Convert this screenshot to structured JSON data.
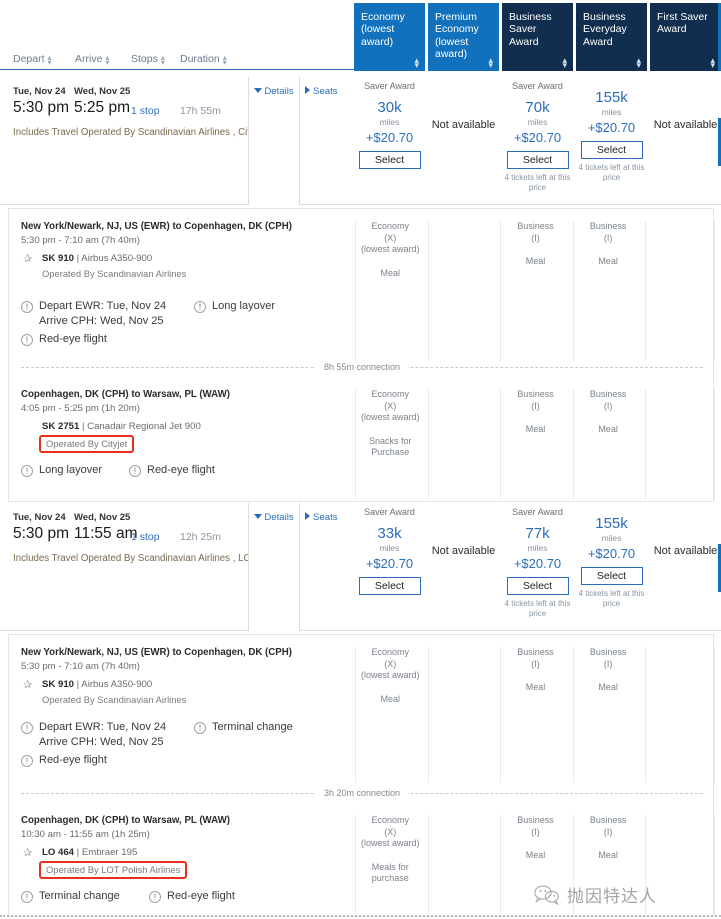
{
  "sort_bar": {
    "items": [
      {
        "label": "Depart",
        "name": "depart"
      },
      {
        "label": "Arrive",
        "name": "arrive"
      },
      {
        "label": "Stops",
        "name": "stops"
      },
      {
        "label": "Duration",
        "name": "duration"
      }
    ]
  },
  "fare_columns": [
    {
      "label": "Economy\n(lowest award)",
      "l1": "Economy",
      "l2": "(lowest",
      "l3": "award)",
      "shade": "light"
    },
    {
      "label": "Premium Economy (lowest award)",
      "l1": "Premium",
      "l2": "Economy",
      "l3": "(lowest",
      "l4": "award)",
      "shade": "light"
    },
    {
      "label": "Business Saver Award",
      "l1": "Business",
      "l2": "Saver Award",
      "shade": "dark"
    },
    {
      "label": "Business Everyday Award",
      "l1": "Business",
      "l2": "Everyday",
      "l3": "Award",
      "shade": "dark"
    },
    {
      "label": "First Saver Award",
      "l1": "First Saver",
      "l2": "Award",
      "shade": "dark"
    }
  ],
  "colors": {
    "header_light_blue": "#1271bc",
    "header_dark_navy": "#122e4f",
    "link_blue": "#2a6ebb",
    "highlight_red": "#e8301e"
  },
  "results": [
    {
      "depart_date": "Tue, Nov 24",
      "depart_time": "5:30 pm",
      "arrive_date": "Wed, Nov 25",
      "arrive_time": "5:25 pm",
      "stops": "1 stop",
      "duration": "17h 55m",
      "includes": "Includes Travel Operated By Scandinavian Airlines , Cityjet",
      "details_label": "Details",
      "seats_label": "Seats",
      "fares": [
        {
          "saver": "Saver Award",
          "miles": "30k",
          "miles_word": "miles",
          "price": "+$20.70",
          "select": "Select",
          "tickets_left": "",
          "not_available": ""
        },
        {
          "saver": "",
          "miles": "",
          "miles_word": "",
          "price": "",
          "select": "",
          "tickets_left": "",
          "not_available": "Not available"
        },
        {
          "saver": "Saver Award",
          "miles": "70k",
          "miles_word": "miles",
          "price": "+$20.70",
          "select": "Select",
          "tickets_left": "4 tickets left at this price",
          "not_available": ""
        },
        {
          "saver": "",
          "miles": "155k",
          "miles_word": "miles",
          "price": "+$20.70",
          "select": "Select",
          "tickets_left": "4 tickets left at this price",
          "not_available": ""
        },
        {
          "saver": "",
          "miles": "",
          "miles_word": "",
          "price": "",
          "select": "",
          "tickets_left": "",
          "not_available": "Not available"
        }
      ],
      "segments": [
        {
          "route": "New York/Newark, NJ, US (EWR) to Copenhagen, DK (CPH)",
          "times": "5:30 pm - 7:10 am (7h 40m)",
          "flight_no": "SK 910",
          "equipment": "Airbus A350-900",
          "operated_by": "Operated By Scandinavian Airlines",
          "operated_highlight": false,
          "notes_left": [
            "Depart EWR: Tue, Nov 24",
            "Arrive CPH: Wed, Nov 25"
          ],
          "note_right": "Long layover",
          "note_bottom": "Red-eye flight",
          "cabins": [
            {
              "l1": "Economy",
              "l2": "(X)",
              "l3": "(lowest award)",
              "meal": "Meal"
            },
            {
              "l1": "",
              "l2": "",
              "l3": "",
              "meal": ""
            },
            {
              "l1": "Business",
              "l2": "(I)",
              "l3": "",
              "meal": "Meal"
            },
            {
              "l1": "Business",
              "l2": "(I)",
              "l3": "",
              "meal": "Meal"
            },
            {
              "l1": "",
              "l2": "",
              "l3": "",
              "meal": ""
            }
          ]
        },
        {
          "connection": "8h 55m connection",
          "route": "Copenhagen, DK (CPH) to Warsaw, PL (WAW)",
          "times": "4:05 pm - 5:25 pm (1h 20m)",
          "flight_no": "SK 2751",
          "equipment": "Canadair Regional Jet 900",
          "operated_by": "Operated By Cityjet",
          "operated_highlight": true,
          "notes_left": [],
          "note_right": "Red-eye flight",
          "note_bottom": "Long layover",
          "cabins": [
            {
              "l1": "Economy",
              "l2": "(X)",
              "l3": "(lowest award)",
              "meal": "Snacks for Purchase"
            },
            {
              "l1": "",
              "l2": "",
              "l3": "",
              "meal": ""
            },
            {
              "l1": "Business",
              "l2": "(I)",
              "l3": "",
              "meal": "Meal"
            },
            {
              "l1": "Business",
              "l2": "(I)",
              "l3": "",
              "meal": "Meal"
            },
            {
              "l1": "",
              "l2": "",
              "l3": "",
              "meal": ""
            }
          ]
        }
      ]
    },
    {
      "depart_date": "Tue, Nov 24",
      "depart_time": "5:30 pm",
      "arrive_date": "Wed, Nov 25",
      "arrive_time": "11:55 am",
      "stops": "1 stop",
      "duration": "12h 25m",
      "includes": "Includes Travel Operated By Scandinavian Airlines , LOT Polis",
      "details_label": "Details",
      "seats_label": "Seats",
      "fares": [
        {
          "saver": "Saver Award",
          "miles": "33k",
          "miles_word": "miles",
          "price": "+$20.70",
          "select": "Select",
          "tickets_left": "",
          "not_available": ""
        },
        {
          "saver": "",
          "miles": "",
          "miles_word": "",
          "price": "",
          "select": "",
          "tickets_left": "",
          "not_available": "Not available"
        },
        {
          "saver": "Saver Award",
          "miles": "77k",
          "miles_word": "miles",
          "price": "+$20.70",
          "select": "Select",
          "tickets_left": "4 tickets left at this price",
          "not_available": ""
        },
        {
          "saver": "",
          "miles": "155k",
          "miles_word": "miles",
          "price": "+$20.70",
          "select": "Select",
          "tickets_left": "4 tickets left at this price",
          "not_available": ""
        },
        {
          "saver": "",
          "miles": "",
          "miles_word": "",
          "price": "",
          "select": "",
          "tickets_left": "",
          "not_available": "Not available"
        }
      ],
      "segments": [
        {
          "route": "New York/Newark, NJ, US (EWR) to Copenhagen, DK (CPH)",
          "times": "5:30 pm - 7:10 am (7h 40m)",
          "flight_no": "SK 910",
          "equipment": "Airbus A350-900",
          "operated_by": "Operated By Scandinavian Airlines",
          "operated_highlight": false,
          "notes_left": [
            "Depart EWR: Tue, Nov 24",
            "Arrive CPH: Wed, Nov 25"
          ],
          "note_right": "Terminal change",
          "note_bottom": "Red-eye flight",
          "cabins": [
            {
              "l1": "Economy",
              "l2": "(X)",
              "l3": "(lowest award)",
              "meal": "Meal"
            },
            {
              "l1": "",
              "l2": "",
              "l3": "",
              "meal": ""
            },
            {
              "l1": "Business",
              "l2": "(I)",
              "l3": "",
              "meal": "Meal"
            },
            {
              "l1": "Business",
              "l2": "(I)",
              "l3": "",
              "meal": "Meal"
            },
            {
              "l1": "",
              "l2": "",
              "l3": "",
              "meal": ""
            }
          ]
        },
        {
          "connection": "3h 20m connection",
          "route": "Copenhagen, DK (CPH) to Warsaw, PL (WAW)",
          "times": "10:30 am - 11:55 am (1h 25m)",
          "flight_no": "LO 464",
          "equipment": "Embraer 195",
          "operated_by": "Operated By LOT Polish Airlines",
          "operated_highlight": true,
          "notes_left": [],
          "note_right": "Red-eye flight",
          "note_bottom": "Terminal change",
          "cabins": [
            {
              "l1": "Economy",
              "l2": "(X)",
              "l3": "(lowest award)",
              "meal": "Meals for purchase"
            },
            {
              "l1": "",
              "l2": "",
              "l3": "",
              "meal": ""
            },
            {
              "l1": "Business",
              "l2": "(I)",
              "l3": "",
              "meal": "Meal"
            },
            {
              "l1": "Business",
              "l2": "(I)",
              "l3": "",
              "meal": "Meal"
            },
            {
              "l1": "",
              "l2": "",
              "l3": "",
              "meal": ""
            }
          ]
        }
      ]
    }
  ],
  "watermark": {
    "text": "抛因特达人"
  }
}
